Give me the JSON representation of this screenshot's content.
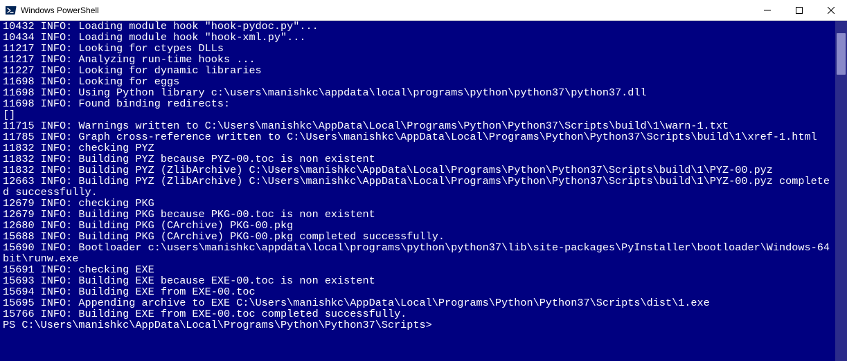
{
  "window": {
    "title": "Windows PowerShell"
  },
  "colors": {
    "terminal_bg": "#000080",
    "terminal_fg": "#ffffff",
    "titlebar_bg": "#ffffff"
  },
  "terminal": {
    "lines": [
      "10432 INFO: Loading module hook \"hook-pydoc.py\"...",
      "10434 INFO: Loading module hook \"hook-xml.py\"...",
      "11217 INFO: Looking for ctypes DLLs",
      "11217 INFO: Analyzing run-time hooks ...",
      "11227 INFO: Looking for dynamic libraries",
      "11698 INFO: Looking for eggs",
      "11698 INFO: Using Python library c:\\users\\manishkc\\appdata\\local\\programs\\python\\python37\\python37.dll",
      "11698 INFO: Found binding redirects:",
      "[]",
      "11715 INFO: Warnings written to C:\\Users\\manishkc\\AppData\\Local\\Programs\\Python\\Python37\\Scripts\\build\\1\\warn-1.txt",
      "11785 INFO: Graph cross-reference written to C:\\Users\\manishkc\\AppData\\Local\\Programs\\Python\\Python37\\Scripts\\build\\1\\xref-1.html",
      "11832 INFO: checking PYZ",
      "11832 INFO: Building PYZ because PYZ-00.toc is non existent",
      "11832 INFO: Building PYZ (ZlibArchive) C:\\Users\\manishkc\\AppData\\Local\\Programs\\Python\\Python37\\Scripts\\build\\1\\PYZ-00.pyz",
      "12663 INFO: Building PYZ (ZlibArchive) C:\\Users\\manishkc\\AppData\\Local\\Programs\\Python\\Python37\\Scripts\\build\\1\\PYZ-00.pyz completed successfully.",
      "12679 INFO: checking PKG",
      "12679 INFO: Building PKG because PKG-00.toc is non existent",
      "12680 INFO: Building PKG (CArchive) PKG-00.pkg",
      "15688 INFO: Building PKG (CArchive) PKG-00.pkg completed successfully.",
      "15690 INFO: Bootloader c:\\users\\manishkc\\appdata\\local\\programs\\python\\python37\\lib\\site-packages\\PyInstaller\\bootloader\\Windows-64bit\\runw.exe",
      "15691 INFO: checking EXE",
      "15693 INFO: Building EXE because EXE-00.toc is non existent",
      "15694 INFO: Building EXE from EXE-00.toc",
      "15695 INFO: Appending archive to EXE C:\\Users\\manishkc\\AppData\\Local\\Programs\\Python\\Python37\\Scripts\\dist\\1.exe",
      "15766 INFO: Building EXE from EXE-00.toc completed successfully.",
      "PS C:\\Users\\manishkc\\AppData\\Local\\Programs\\Python\\Python37\\Scripts>"
    ]
  }
}
